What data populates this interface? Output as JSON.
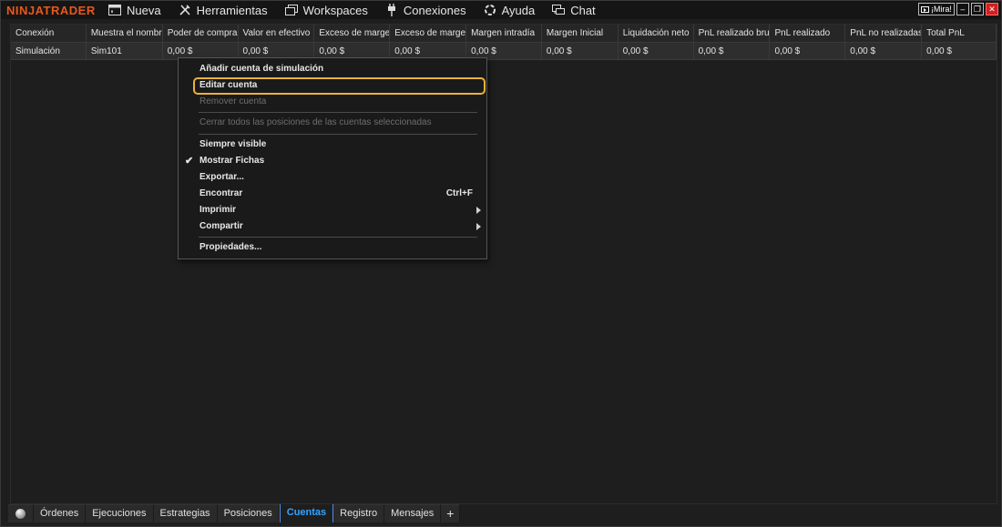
{
  "app": {
    "logo": "NINJATRADER"
  },
  "menu": [
    {
      "label": "Nueva",
      "icon": "new-window-icon"
    },
    {
      "label": "Herramientas",
      "icon": "tools-icon"
    },
    {
      "label": "Workspaces",
      "icon": "workspaces-icon"
    },
    {
      "label": "Conexiones",
      "icon": "plug-icon"
    },
    {
      "label": "Ayuda",
      "icon": "help-ring-icon"
    },
    {
      "label": "Chat",
      "icon": "chat-icon"
    }
  ],
  "window_controls": {
    "mira": "¡Mira!",
    "minimize": "–",
    "restore": "❐",
    "close": "✕"
  },
  "grid": {
    "headers": [
      "Conexión",
      "Muestra el nombre",
      "Poder de compra",
      "Valor en efectivo",
      "Exceso de margen",
      "Exceso de margen",
      "Margen intradía",
      "Margen Inicial",
      "Liquidación neto",
      "PnL realizado bruto",
      "PnL realizado",
      "PnL no realizadas",
      "Total PnL"
    ],
    "rows": [
      [
        "Simulación",
        "Sim101",
        "0,00 $",
        "0,00 $",
        "0,00 $",
        "0,00 $",
        "0,00 $",
        "0,00 $",
        "0,00 $",
        "0,00 $",
        "0,00 $",
        "0,00 $",
        "0,00 $"
      ]
    ]
  },
  "context_menu": {
    "add_sim": "Añadir cuenta de simulación",
    "edit": "Editar cuenta",
    "remove": "Remover cuenta",
    "close_all": "Cerrar todos las posiciones de las cuentas seleccionadas",
    "always_visible": "Siempre visible",
    "show_tabs": "Mostrar Fichas",
    "export": "Exportar...",
    "find": "Encontrar",
    "find_shortcut": "Ctrl+F",
    "print": "Imprimir",
    "share": "Compartir",
    "properties": "Propiedades..."
  },
  "tabs": [
    "Órdenes",
    "Ejecuciones",
    "Estrategias",
    "Posiciones",
    "Cuentas",
    "Registro",
    "Mensajes"
  ],
  "active_tab": "Cuentas",
  "colors": {
    "accent": "#e8581c",
    "highlight": "#e8b23a",
    "active_tab": "#34a3ff"
  }
}
